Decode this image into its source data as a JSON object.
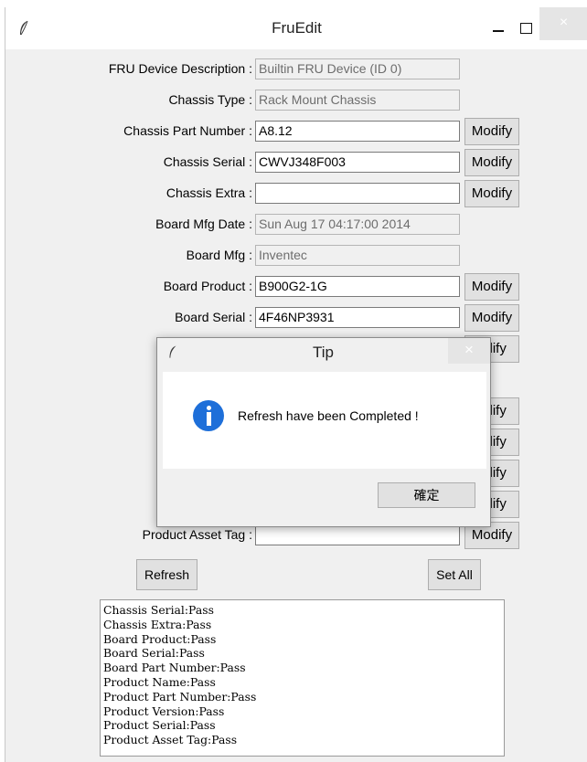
{
  "window": {
    "title": "FruEdit",
    "minimize": "_",
    "maximize": "□",
    "close": "×"
  },
  "fields": [
    {
      "label": "FRU Device Description :",
      "value": "Builtin FRU Device (ID 0)",
      "readonly": true,
      "modify": ""
    },
    {
      "label": "Chassis Type :",
      "value": "Rack Mount Chassis",
      "readonly": true,
      "modify": ""
    },
    {
      "label": "Chassis Part Number :",
      "value": "A8.12",
      "readonly": false,
      "modify": "Modify"
    },
    {
      "label": "Chassis Serial :",
      "value": "CWVJ348F003",
      "readonly": false,
      "modify": "Modify"
    },
    {
      "label": "Chassis Extra :",
      "value": "",
      "readonly": false,
      "modify": "Modify"
    },
    {
      "label": "Board Mfg Date :",
      "value": "Sun Aug 17 04:17:00 2014",
      "readonly": true,
      "modify": ""
    },
    {
      "label": "Board Mfg :",
      "value": "Inventec",
      "readonly": true,
      "modify": ""
    },
    {
      "label": "Board Product :",
      "value": "B900G2-1G",
      "readonly": false,
      "modify": "Modify"
    },
    {
      "label": "Board Serial :",
      "value": "4F46NP3931",
      "readonly": false,
      "modify": "Modify"
    },
    {
      "label": "Boarc",
      "value": "",
      "readonly": false,
      "modify": "odify"
    },
    {
      "label": "Product",
      "value": "",
      "readonly": false,
      "modify": ""
    },
    {
      "label": "I",
      "value": "",
      "readonly": false,
      "modify": "odify"
    },
    {
      "label": "Produc",
      "value": "",
      "readonly": false,
      "modify": "odify"
    },
    {
      "label": "Pr",
      "value": "",
      "readonly": false,
      "modify": "odify"
    },
    {
      "label": "",
      "value": "",
      "readonly": false,
      "modify": "odify"
    },
    {
      "label": "Product Asset Tag :",
      "value": "",
      "readonly": false,
      "modify": "Modify"
    }
  ],
  "buttons": {
    "refresh": "Refresh",
    "set_all": "Set All"
  },
  "log": "Chassis Serial:Pass\nChassis Extra:Pass\nBoard Product:Pass\nBoard Serial:Pass\nBoard Part Number:Pass\nProduct Name:Pass\nProduct Part Number:Pass\nProduct Version:Pass\nProduct Serial:Pass\nProduct Asset Tag:Pass",
  "dialog": {
    "title": "Tip",
    "close": "×",
    "message": "Refresh have been Completed !",
    "ok": "確定"
  }
}
